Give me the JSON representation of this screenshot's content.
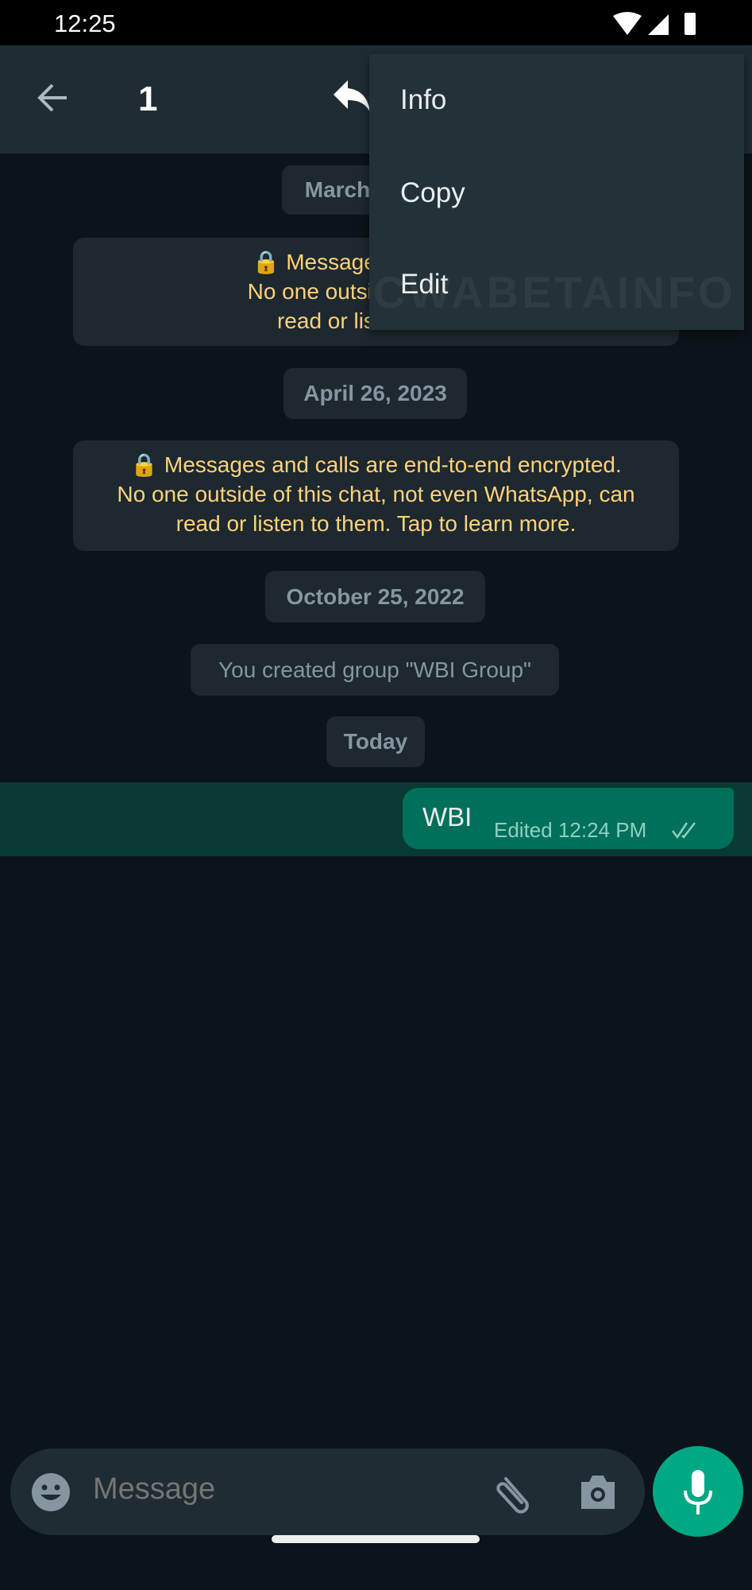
{
  "status_bar": {
    "time": "12:25",
    "icons": [
      "wifi-icon",
      "signal-icon",
      "battery-icon"
    ]
  },
  "header": {
    "selected_count": "1",
    "icons": [
      "back-arrow-icon",
      "reply-icon"
    ]
  },
  "context_menu": {
    "items": [
      "Info",
      "Copy",
      "Edit"
    ]
  },
  "watermark": "CWABETAINFO",
  "chat": {
    "date_1": "March",
    "encryption_1": {
      "line1": "Messages and calls a",
      "line2": "No one outside of this cha",
      "line3": "read or listen to ther"
    },
    "date_2": "April 26, 2023",
    "encryption_2": {
      "line1": "Messages and calls are end-to-end encrypted.",
      "line2": "No one outside of this chat, not even WhatsApp, can",
      "line3": "read or listen to them. Tap to learn more."
    },
    "date_3": "October 25, 2022",
    "system_message": "You created group \"WBI Group\"",
    "date_4": "Today",
    "message": {
      "text": "WBI",
      "meta": "Edited 12:24 PM",
      "status": "read"
    }
  },
  "composer": {
    "placeholder": "Message"
  },
  "colors": {
    "bubble": "#00705a",
    "accent": "#00a884",
    "encryption_text": "#ffd279"
  }
}
